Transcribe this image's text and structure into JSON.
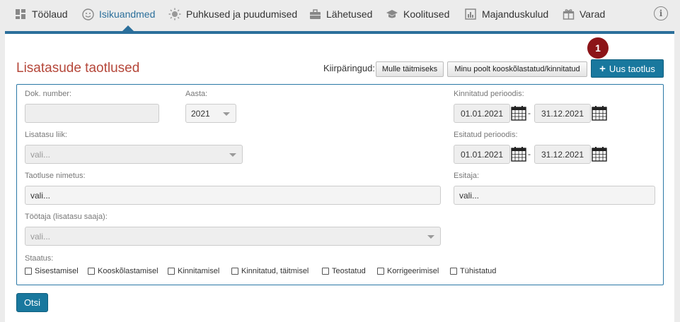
{
  "nav": {
    "items": [
      {
        "label": "Töölaud",
        "icon": "dashboard-icon"
      },
      {
        "label": "Isikuandmed",
        "icon": "person-icon"
      },
      {
        "label": "Puhkused ja puudumised",
        "icon": "sun-icon"
      },
      {
        "label": "Lähetused",
        "icon": "briefcase-icon"
      },
      {
        "label": "Koolitused",
        "icon": "graduation-cap-icon"
      },
      {
        "label": "Majanduskulud",
        "icon": "bar-chart-icon"
      },
      {
        "label": "Varad",
        "icon": "gift-icon"
      }
    ],
    "active_index": 1,
    "info_glyph": "i",
    "accent_color": "#2b6f9b"
  },
  "page": {
    "title": "Lisatasude taotlused",
    "title_color": "#b5473a",
    "quick_label": "Kiirpäringud:",
    "quick_buttons": [
      "Mulle täitmiseks",
      "Minu poolt kooskõlastatud/kinnitatud"
    ],
    "new_button": "Uus taotlus",
    "new_button_glyph": "+",
    "badge": "1"
  },
  "form": {
    "doc_number": {
      "label": "Dok. number:",
      "value": ""
    },
    "year": {
      "label": "Aasta:",
      "value": "2021"
    },
    "approved_period": {
      "label": "Kinnitatud perioodis:",
      "from": "01.01.2021",
      "to": "31.12.2021"
    },
    "submitted_period": {
      "label": "Esitatud perioodis:",
      "from": "01.01.2021",
      "to": "31.12.2021"
    },
    "bonus_type": {
      "label": "Lisatasu liik:",
      "placeholder": "vali..."
    },
    "application_name": {
      "label": "Taotluse nimetus:",
      "placeholder": "vali..."
    },
    "submitter": {
      "label": "Esitaja:",
      "placeholder": "vali..."
    },
    "employee": {
      "label": "Töötaja (lisatasu saaja):",
      "placeholder": "vali..."
    },
    "period_separator": "-",
    "status": {
      "label": "Staatus:",
      "options": [
        "Sisestamisel",
        "Kooskõlastamisel",
        "Kinnitamisel",
        "Kinnitatud, täitmisel",
        "Teostatud",
        "Korrigeerimisel",
        "Tühistatud"
      ]
    }
  },
  "search_button": "Otsi"
}
